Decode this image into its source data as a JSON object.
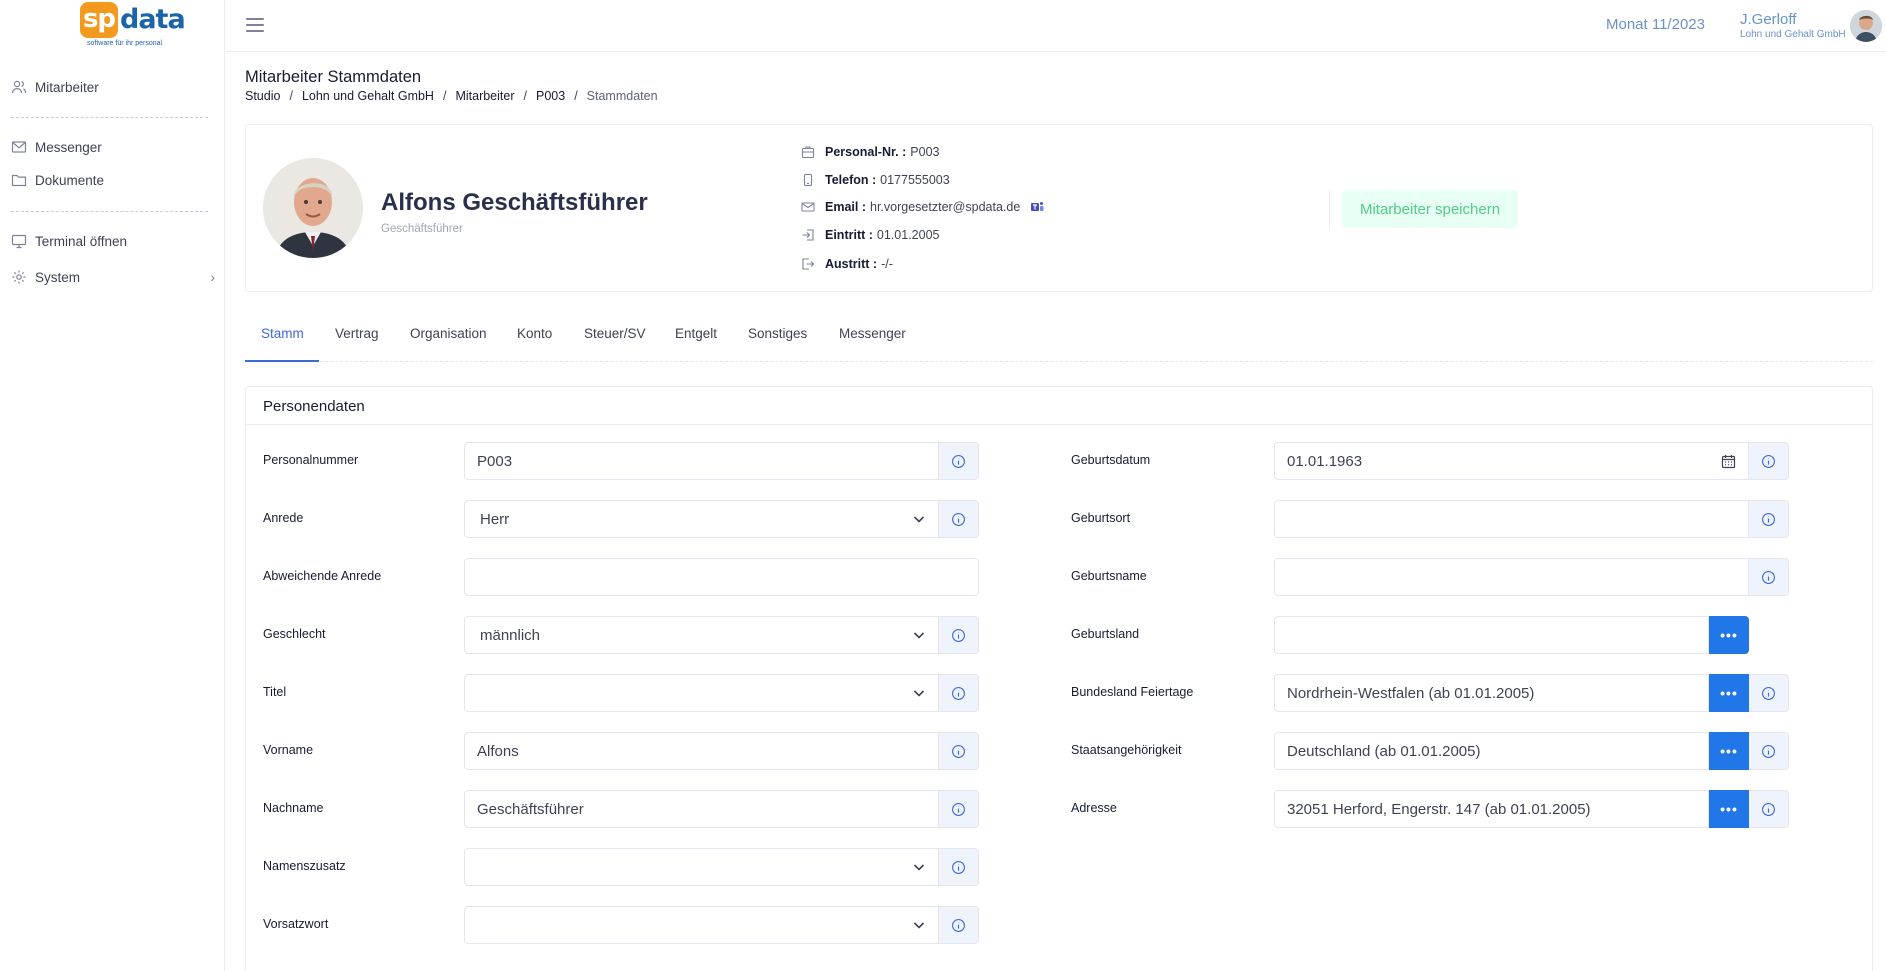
{
  "logo": {
    "part1": "sp",
    "part2": "data",
    "tagline": "software für ihr personal"
  },
  "sidebar": {
    "items": [
      {
        "label": "Mitarbeiter",
        "icon": "users-icon"
      },
      {
        "label": "Messenger",
        "icon": "mail-icon"
      },
      {
        "label": "Dokumente",
        "icon": "folder-icon"
      },
      {
        "label": "Terminal öffnen",
        "icon": "monitor-icon"
      },
      {
        "label": "System",
        "icon": "gear-icon"
      }
    ]
  },
  "topbar": {
    "month": "Monat 11/2023",
    "user_name": "J.Gerloff",
    "user_company": "Lohn und Gehalt GmbH"
  },
  "header": {
    "title": "Mitarbeiter Stammdaten",
    "breadcrumb": [
      "Studio",
      "Lohn und Gehalt GmbH",
      "Mitarbeiter",
      "P003",
      "Stammdaten"
    ]
  },
  "profile": {
    "name": "Alfons Geschäftsführer",
    "role": "Geschäftsführer",
    "personal_nr_label": "Personal-Nr. :",
    "personal_nr": "P003",
    "telefon_label": "Telefon :",
    "telefon": "0177555003",
    "email_label": "Email :",
    "email": "hr.vorgesetzter@spdata.de",
    "eintritt_label": "Eintritt :",
    "eintritt": "01.01.2005",
    "austritt_label": "Austritt :",
    "austritt": "-/-",
    "save_label": "Mitarbeiter speichern"
  },
  "tabs": [
    "Stamm",
    "Vertrag",
    "Organisation",
    "Konto",
    "Steuer/SV",
    "Entgelt",
    "Sonstiges",
    "Messenger"
  ],
  "active_tab": "Stamm",
  "card": {
    "title": "Personendaten",
    "left": [
      {
        "label": "Personalnummer",
        "value": "P003",
        "type": "text"
      },
      {
        "label": "Anrede",
        "value": "Herr",
        "type": "select"
      },
      {
        "label": "Abweichende Anrede",
        "value": "",
        "type": "text"
      },
      {
        "label": "Geschlecht",
        "value": "männlich",
        "type": "select"
      },
      {
        "label": "Titel",
        "value": "",
        "type": "select"
      },
      {
        "label": "Vorname",
        "value": "Alfons",
        "type": "text"
      },
      {
        "label": "Nachname",
        "value": "Geschäftsführer",
        "type": "text"
      },
      {
        "label": "Namenszusatz",
        "value": "",
        "type": "select"
      },
      {
        "label": "Vorsatzwort",
        "value": "",
        "type": "select"
      }
    ],
    "right": [
      {
        "label": "Geburtsdatum",
        "value": "01.01.1963",
        "type": "date"
      },
      {
        "label": "Geburtsort",
        "value": "",
        "type": "text"
      },
      {
        "label": "Geburtsname",
        "value": "",
        "type": "text"
      },
      {
        "label": "Geburtsland",
        "value": "",
        "type": "lookup"
      },
      {
        "label": "Bundesland Feiertage",
        "value": "Nordrhein-Westfalen (ab 01.01.2005)",
        "type": "lookup"
      },
      {
        "label": "Staatsangehörigkeit",
        "value": "Deutschland (ab 01.01.2005)",
        "type": "lookup"
      },
      {
        "label": "Adresse",
        "value": "32051 Herford, Engerstr. 147 (ab 01.01.2005)",
        "type": "lookup"
      }
    ]
  },
  "colors": {
    "accent": "#3e6ad6",
    "primary_button": "#2176e8",
    "success_light": "#e8fff3",
    "success": "#50cd89",
    "logo_orange": "#f39a1e",
    "logo_blue": "#1c64a8"
  }
}
